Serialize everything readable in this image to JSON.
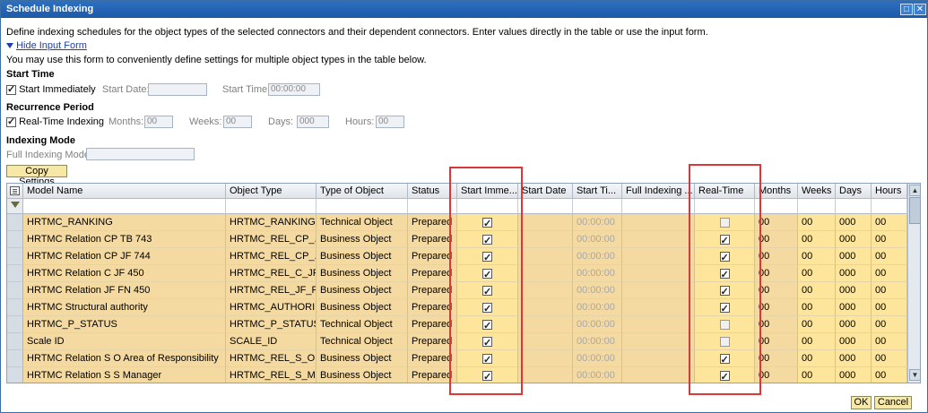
{
  "window": {
    "title": "Schedule Indexing",
    "maximize_icon": "□",
    "close_icon": "✕"
  },
  "intro": {
    "description": "Define indexing schedules for the object types of the selected connectors and their dependent connectors. Enter values directly in the table or use the input form.",
    "toggle_link": "Hide Input Form",
    "form_hint": "You may use this form to conveniently define settings for multiple object types in the table below."
  },
  "start_time": {
    "heading": "Start Time",
    "start_immediately_label": "Start Immediately",
    "start_immediately_checked": true,
    "start_date_label": "Start Date:",
    "start_date_value": "",
    "start_time_label": "Start Time:",
    "start_time_value": "00:00:00"
  },
  "recurrence": {
    "heading": "Recurrence Period",
    "realtime_label": "Real-Time Indexing",
    "realtime_checked": true,
    "months_label": "Months:",
    "months_value": "00",
    "weeks_label": "Weeks:",
    "weeks_value": "00",
    "days_label": "Days:",
    "days_value": "000",
    "hours_label": "Hours:",
    "hours_value": "00"
  },
  "indexing_mode": {
    "heading": "Indexing Mode",
    "full_label": "Full Indexing Mode:",
    "full_value": ""
  },
  "copy_button": "Copy Settings",
  "table": {
    "columns": [
      "Model Name",
      "Object Type",
      "Type of Object Type",
      "Status",
      "Start Imme...",
      "Start Date",
      "Start Ti...",
      "Full Indexing ...",
      "Real-Time ...",
      "Months",
      "Weeks",
      "Days",
      "Hours"
    ],
    "rows": [
      {
        "model": "HRTMC_RANKING",
        "otype": "HRTMC_RANKING",
        "type": "Technical Object",
        "status": "Prepared",
        "start_imm": true,
        "start_date": "",
        "start_time": "00:00:00",
        "full": "",
        "realtime": false,
        "months": "00",
        "weeks": "00",
        "days": "000",
        "hours": "00"
      },
      {
        "model": "HRTMC Relation CP TB 743",
        "otype": "HRTMC_REL_CP_...",
        "type": "Business Object",
        "status": "Prepared",
        "start_imm": true,
        "start_date": "",
        "start_time": "00:00:00",
        "full": "",
        "realtime": true,
        "months": "00",
        "weeks": "00",
        "days": "000",
        "hours": "00"
      },
      {
        "model": "HRTMC Relation CP JF 744",
        "otype": "HRTMC_REL_CP_...",
        "type": "Business Object",
        "status": "Prepared",
        "start_imm": true,
        "start_date": "",
        "start_time": "00:00:00",
        "full": "",
        "realtime": true,
        "months": "00",
        "weeks": "00",
        "days": "000",
        "hours": "00"
      },
      {
        "model": "HRTMC Relation C JF 450",
        "otype": "HRTMC_REL_C_JF...",
        "type": "Business Object",
        "status": "Prepared",
        "start_imm": true,
        "start_date": "",
        "start_time": "00:00:00",
        "full": "",
        "realtime": true,
        "months": "00",
        "weeks": "00",
        "days": "000",
        "hours": "00"
      },
      {
        "model": "HRTMC Relation JF FN 450",
        "otype": "HRTMC_REL_JF_F...",
        "type": "Business Object",
        "status": "Prepared",
        "start_imm": true,
        "start_date": "",
        "start_time": "00:00:00",
        "full": "",
        "realtime": true,
        "months": "00",
        "weeks": "00",
        "days": "000",
        "hours": "00"
      },
      {
        "model": "HRTMC Structural authority",
        "otype": "HRTMC_AUTHORI...",
        "type": "Business Object",
        "status": "Prepared",
        "start_imm": true,
        "start_date": "",
        "start_time": "00:00:00",
        "full": "",
        "realtime": true,
        "months": "00",
        "weeks": "00",
        "days": "000",
        "hours": "00"
      },
      {
        "model": "HRTMC_P_STATUS",
        "otype": "HRTMC_P_STATUS",
        "type": "Technical Object",
        "status": "Prepared",
        "start_imm": true,
        "start_date": "",
        "start_time": "00:00:00",
        "full": "",
        "realtime": false,
        "months": "00",
        "weeks": "00",
        "days": "000",
        "hours": "00"
      },
      {
        "model": "Scale ID",
        "otype": "SCALE_ID",
        "type": "Technical Object",
        "status": "Prepared",
        "start_imm": true,
        "start_date": "",
        "start_time": "00:00:00",
        "full": "",
        "realtime": false,
        "months": "00",
        "weeks": "00",
        "days": "000",
        "hours": "00"
      },
      {
        "model": "HRTMC Relation S O Area of Responsibility",
        "otype": "HRTMC_REL_S_O...",
        "type": "Business Object",
        "status": "Prepared",
        "start_imm": true,
        "start_date": "",
        "start_time": "00:00:00",
        "full": "",
        "realtime": true,
        "months": "00",
        "weeks": "00",
        "days": "000",
        "hours": "00"
      },
      {
        "model": "HRTMC Relation S S Manager",
        "otype": "HRTMC_REL_S_M...",
        "type": "Business Object",
        "status": "Prepared",
        "start_imm": true,
        "start_date": "",
        "start_time": "00:00:00",
        "full": "",
        "realtime": true,
        "months": "00",
        "weeks": "00",
        "days": "000",
        "hours": "00"
      }
    ]
  },
  "footer": {
    "ok": "OK",
    "cancel": "Cancel"
  },
  "colors": {
    "highlight_box": "#d9383a",
    "row_tan": "#f4d9a1",
    "row_yellow": "#fee59c",
    "title_blue": "#1b5aa8"
  },
  "icons": {
    "column_settings": "table-settings-icon",
    "filter": "filter-icon",
    "collapse": "triangle-down-icon"
  }
}
